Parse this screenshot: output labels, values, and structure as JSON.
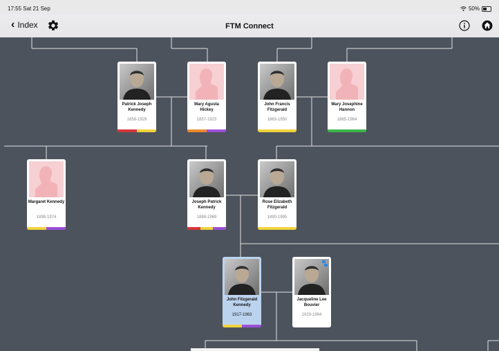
{
  "status": {
    "time": "17:55  Sat 21 Sep",
    "battery": "50%"
  },
  "nav": {
    "back_label": "Index",
    "title": "FTM Connect"
  },
  "colors": {
    "red": "#d6343b",
    "yellow": "#f0d33d",
    "purple": "#9a4fd9",
    "orange": "#ef8a2c",
    "green": "#3cb64b"
  },
  "people": [
    {
      "name": "Patrick Joseph Kennedy",
      "dates": "1858-1929",
      "photo": "photo",
      "bars": [
        "red",
        "yellow"
      ]
    },
    {
      "name": "Mary Agusta Hickey",
      "dates": "1857-1923",
      "photo": "silhouette",
      "bars": [
        "orange",
        "purple"
      ]
    },
    {
      "name": "John Francis Fitzgerald",
      "dates": "1863-1950",
      "photo": "photo",
      "bars": [
        "yellow"
      ]
    },
    {
      "name": "Mary Josephine Hannon",
      "dates": "1865-1964",
      "photo": "silhouette",
      "bars": [
        "green"
      ]
    },
    {
      "name": "Margaret Kennedy",
      "dates": "1898-1974",
      "photo": "silhouette",
      "bars": [
        "yellow",
        "purple"
      ]
    },
    {
      "name": "Joseph Patrick Kennedy",
      "dates": "1888-1969",
      "photo": "photo",
      "bars": [
        "red",
        "yellow",
        "purple"
      ]
    },
    {
      "name": "Rose Elizabeth Fitzgerald",
      "dates": "1890-1995",
      "photo": "photo",
      "bars": [
        "yellow"
      ]
    },
    {
      "name": "John Fitzgerald Kennedy",
      "dates": "1917-1963",
      "photo": "photo",
      "bars": [
        "yellow",
        "purple"
      ],
      "selected": true
    },
    {
      "name": "Jacqueline Lee Bouvier",
      "dates": "1929-1994",
      "photo": "photo",
      "bars": [],
      "shared": true
    }
  ]
}
